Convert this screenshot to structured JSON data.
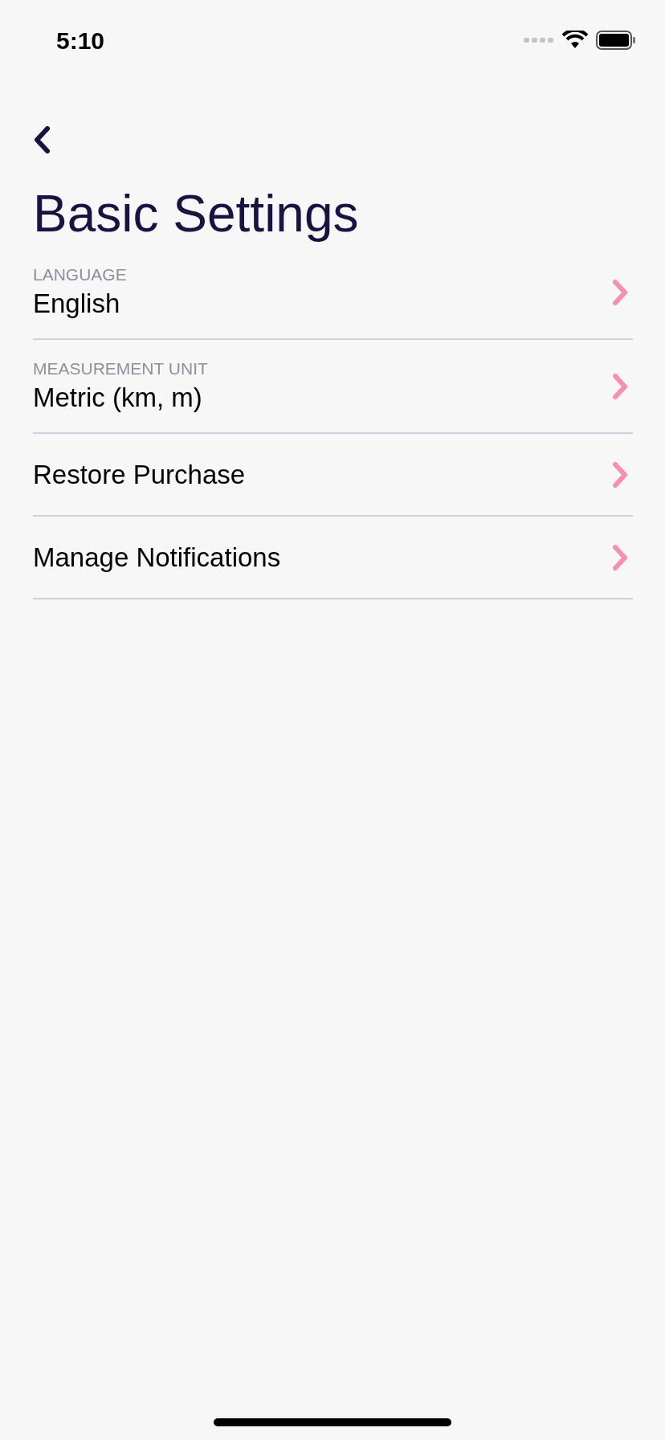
{
  "status_bar": {
    "time": "5:10"
  },
  "title": "Basic Settings",
  "rows": [
    {
      "label": "LANGUAGE",
      "value": "English"
    },
    {
      "label": "MEASUREMENT UNIT",
      "value": "Metric (km, m)"
    },
    {
      "value": "Restore Purchase"
    },
    {
      "value": "Manage Notifications"
    }
  ]
}
